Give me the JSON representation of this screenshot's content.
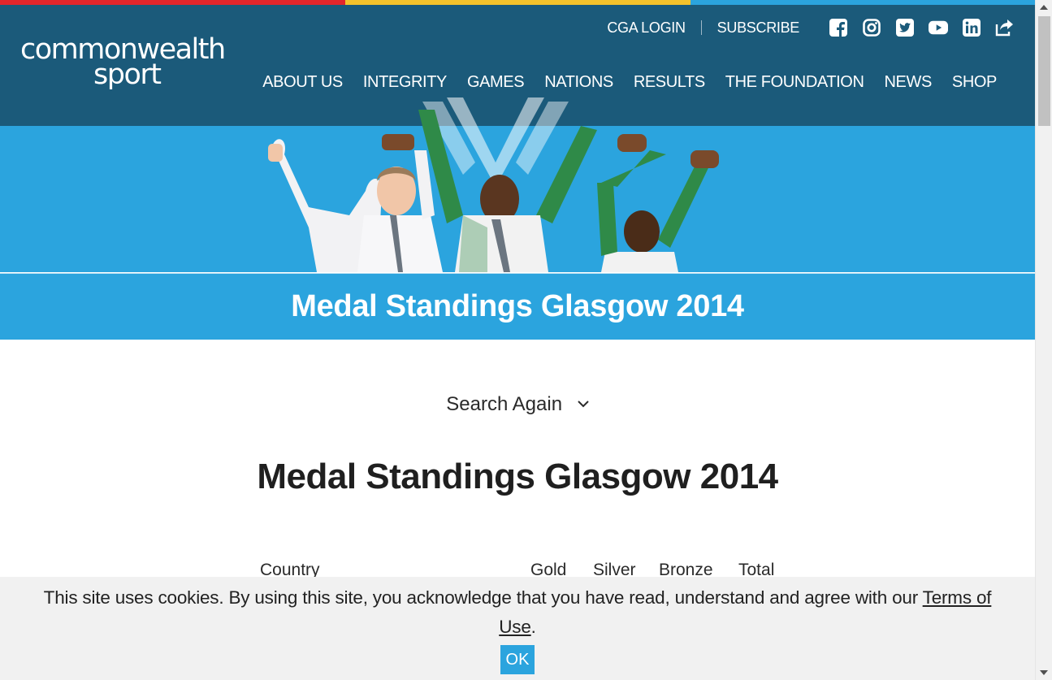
{
  "brand": {
    "logo_line1": "commonwealth",
    "logo_line2": "sport"
  },
  "colors": {
    "stripe": [
      "#e3262b",
      "#f4c22b",
      "#2ba4de"
    ],
    "header": "#1b5a7a",
    "accent": "#2ba4de"
  },
  "topbar": {
    "login_label": "CGA LOGIN",
    "subscribe_label": "SUBSCRIBE",
    "social_icons": [
      "facebook-icon",
      "instagram-icon",
      "twitter-icon",
      "youtube-icon",
      "linkedin-icon",
      "share-icon"
    ]
  },
  "nav": {
    "items": [
      "ABOUT US",
      "INTEGRITY",
      "GAMES",
      "NATIONS",
      "RESULTS",
      "THE FOUNDATION",
      "NEWS",
      "SHOP"
    ]
  },
  "hero": {
    "title": "Medal Standings Glasgow 2014"
  },
  "search": {
    "label": "Search Again"
  },
  "main": {
    "title": "Medal Standings Glasgow 2014"
  },
  "table": {
    "headers": {
      "country": "Country",
      "gold": "Gold",
      "silver": "Silver",
      "bronze": "Bronze",
      "total": "Total"
    }
  },
  "cookie": {
    "text": "This site uses cookies. By using this site, you acknowledge that you have read, understand and agree with our ",
    "link": "Terms of Use",
    "suffix": ".",
    "ok_label": "OK"
  }
}
